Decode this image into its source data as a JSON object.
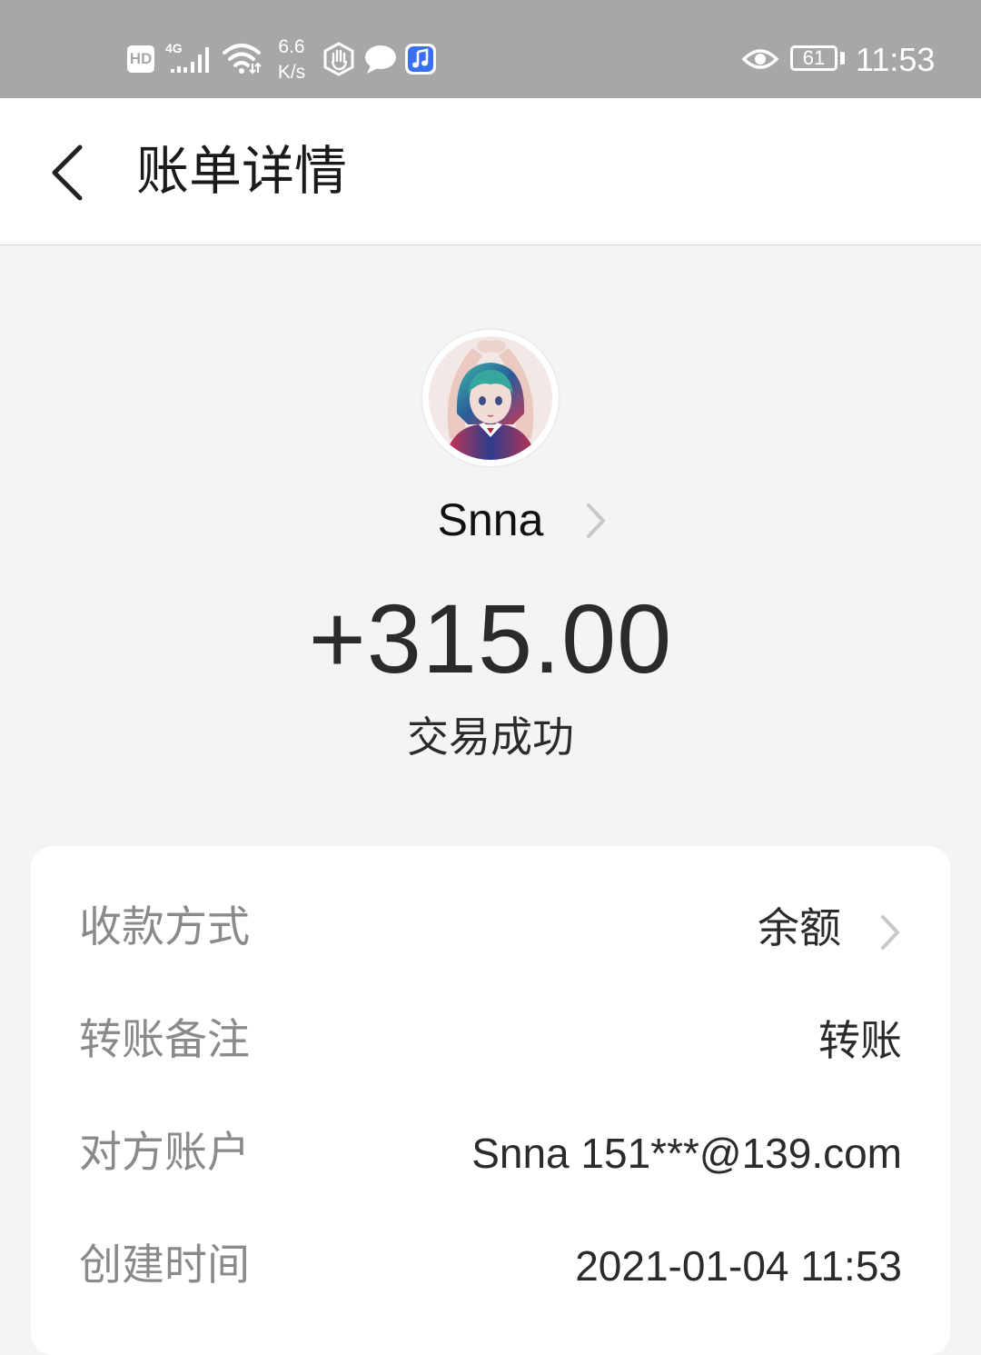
{
  "status_bar": {
    "hd_label": "HD",
    "network_label": "4G",
    "speed_value": "6.6",
    "speed_unit": "K/s",
    "battery_level": "61",
    "time": "11:53",
    "icons": [
      "hd-icon",
      "signal-icon",
      "wifi-icon",
      "hand-icon",
      "chat-icon",
      "music-icon",
      "eye-icon",
      "battery-icon"
    ]
  },
  "header": {
    "back_icon": "chevron-left-icon",
    "title": "账单详情"
  },
  "summary": {
    "payer_name": "Snna",
    "amount": "+315.00",
    "status": "交易成功"
  },
  "details": [
    {
      "label": "收款方式",
      "value": "余额",
      "has_chevron": true
    },
    {
      "label": "转账备注",
      "value": "转账",
      "has_chevron": false
    },
    {
      "label": "对方账户",
      "value": "Snna 151***@139.com",
      "has_chevron": false
    },
    {
      "label": "创建时间",
      "value": "2021-01-04 11:53",
      "has_chevron": false
    }
  ],
  "colors": {
    "status_bar_bg": "#a7a7a7",
    "page_bg": "#f4f4f4",
    "card_bg": "#ffffff",
    "text_primary": "#2b2b2b",
    "text_label": "#8a8a8a",
    "chevron": "#c8c8c8"
  }
}
